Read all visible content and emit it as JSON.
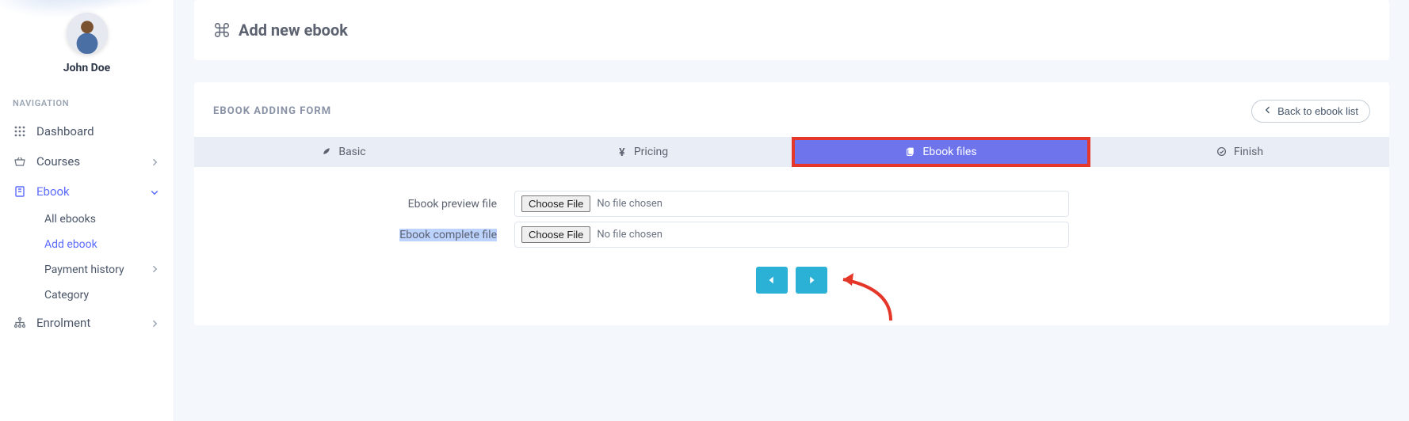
{
  "user": {
    "name": "John Doe"
  },
  "nav": {
    "header": "NAVIGATION",
    "items": {
      "dashboard": "Dashboard",
      "courses": "Courses",
      "ebook": "Ebook",
      "enrolment": "Enrolment"
    },
    "ebook_sub": {
      "all": "All ebooks",
      "add": "Add ebook",
      "payment": "Payment history",
      "category": "Category"
    }
  },
  "page": {
    "title": "Add new ebook",
    "form_title": "EBOOK ADDING FORM",
    "back_button": "Back to ebook list"
  },
  "tabs": {
    "basic": "Basic",
    "pricing": "Pricing",
    "files": "Ebook files",
    "finish": "Finish"
  },
  "form": {
    "preview_label": "Ebook preview file",
    "complete_label": "Ebook complete file",
    "choose_button": "Choose File",
    "no_file": "No file chosen"
  }
}
